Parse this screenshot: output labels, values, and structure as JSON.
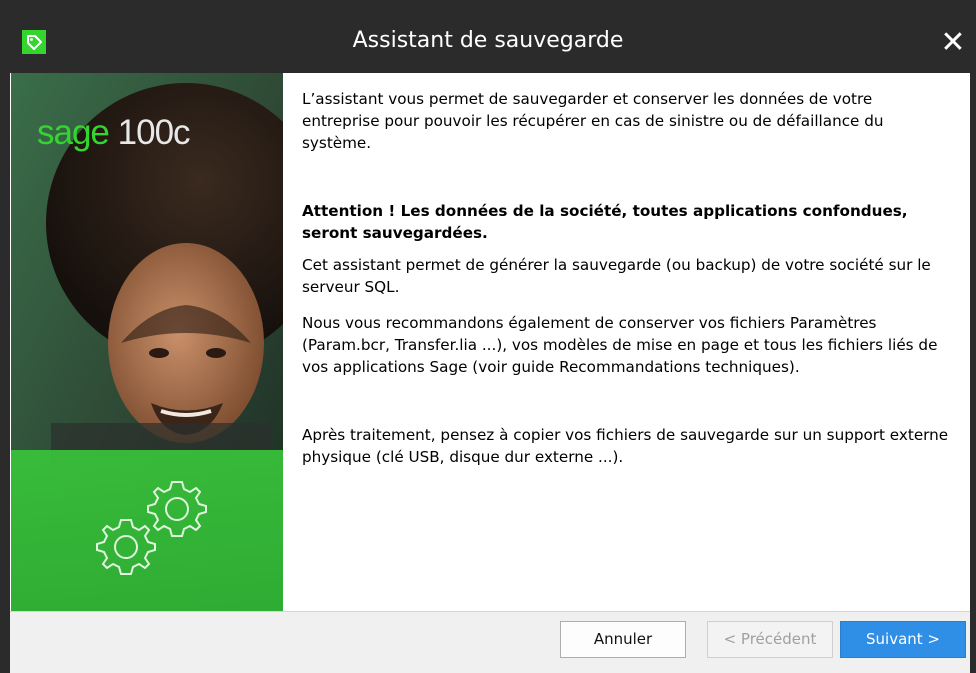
{
  "window": {
    "title": "Assistant de sauvegarde",
    "close_glyph": "✕",
    "app_icon": "sage-tag-icon"
  },
  "sidebar": {
    "logo_brand": "sage",
    "logo_product": "100c",
    "illustration": "gears-icon"
  },
  "body": {
    "p1": "L’assistant vous permet de sauvegarder et conserver les données de votre entreprise pour pouvoir les récupérer en cas de sinistre ou de défaillance du système.",
    "p2": "Attention ! Les données de la société, toutes applications confondues, seront sauvegardées.",
    "p3": "Cet assistant permet de générer la sauvegarde (ou backup) de votre société sur le serveur SQL.",
    "p4": "Nous vous recommandons également de conserver vos fichiers Paramètres (Param.bcr, Transfer.lia ...), vos modèles de mise en page et tous les fichiers liés de vos applications Sage (voir guide Recommandations techniques).",
    "p5": "Après traitement, pensez à copier vos fichiers de sauvegarde sur un support externe physique (clé USB, disque dur externe ...)."
  },
  "buttons": {
    "cancel": "Annuler",
    "previous": "< Précédent",
    "next": "Suivant >"
  },
  "colors": {
    "brand_green": "#35d52f",
    "primary_blue": "#2f8ee5",
    "titlebar": "#2b2b2b"
  }
}
